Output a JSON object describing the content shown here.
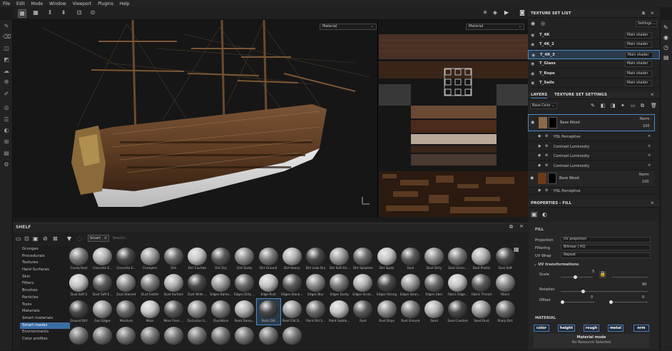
{
  "menu": [
    "File",
    "Edit",
    "Mode",
    "Window",
    "Viewport",
    "Plugins",
    "Help"
  ],
  "viewport": {
    "material_3d": "Material",
    "material_2d": "Material"
  },
  "shelf": {
    "title": "SHELF",
    "filter_tag": "Smart",
    "search_placeholder": "Search...",
    "categories": [
      "Grunges",
      "Procedurals",
      "Textures",
      "Hard Surfaces",
      "Skin",
      "Filters",
      "Brushes",
      "Particles",
      "Tools",
      "Materials",
      "Smart materials",
      "Smart masks",
      "Environments",
      "Color profiles"
    ],
    "selected_category": "Smart masks",
    "items": [
      [
        "Cavity Rust",
        "Concrete E...",
        "Concrete E...",
        "Crumples",
        "Dirt",
        "Dirt Cavities",
        "Dirt Dry",
        "Dirt Dusty",
        "Dirt Ground",
        "Dirt Heavy",
        "Dirt Leak Dry",
        "Dirt Soft Ed...",
        "Dirt Splashes",
        "Dirt Spots",
        "Dust",
        "Dust Dirty",
        "Dust Occlu...",
        "Dust Plastic",
        "Dust Soft"
      ],
      [
        "Dust Soft 2",
        "Dust Soft E...",
        "Dust Stained",
        "Dust Subtle",
        "Dust Surface",
        "Dust Wide ...",
        "Edges Dama...",
        "Edges Dirty ...",
        "Edge Rust",
        "Edges Stone...",
        "Edges Blur",
        "Edges Dusty",
        "Edges Scrat...",
        "Edges Strong",
        "Edges Stron...",
        "Edges Uber",
        "Fabric Edge...",
        "Fabric Thread",
        "Fibers"
      ],
      [
        "Ground Dirt",
        "Gun Edges",
        "Moisture",
        "Moss",
        "Moss From ...",
        "Occlusion S...",
        "Oxydation",
        "Paint Dama...",
        "Paint Old",
        "Paint Old D...",
        "Paint Old S...",
        "Paint Subtle...",
        "Rust",
        "Rust Drips",
        "Rust Ground",
        "Sand",
        "Sand Cavities",
        "Sand Dust",
        "Sharp Dirt"
      ]
    ],
    "selected_item": "Paint Old"
  },
  "texture_set_list": {
    "title": "TEXTURE SET LIST",
    "settings_label": "Settings",
    "sets": [
      {
        "name": "T_4K",
        "shader": "Main shader"
      },
      {
        "name": "T_4K_2",
        "shader": "Main shader"
      },
      {
        "name": "T_4K_3",
        "shader": "Main shader"
      },
      {
        "name": "T_Glass",
        "shader": "Main shader"
      },
      {
        "name": "T_Rope",
        "shader": "Main shader"
      },
      {
        "name": "T_Sails",
        "shader": "Main shader"
      }
    ],
    "selected": "T_4K_3"
  },
  "layers": {
    "tab_layers": "LAYERS",
    "tab_tss": "TEXTURE SET SETTINGS",
    "channel": "Base Color",
    "group1": {
      "name": "Base Wood",
      "blend": "Norm",
      "opacity": "100"
    },
    "effects": [
      "HSL Perceptive",
      "Contrast Luminosity",
      "Contrast Luminosity",
      "Contrast Luminosity"
    ],
    "group2": {
      "name": "Base Wood",
      "blend": "Norm",
      "opacity": "100"
    },
    "effects2": [
      "HSL Perceptive"
    ]
  },
  "properties": {
    "title": "PROPERTIES - FILL",
    "section_fill": "FILL",
    "projection_label": "Projection",
    "projection": "UV projection",
    "filtering_label": "Filtering",
    "filtering": "Bilinear | HQ",
    "uvwrap_label": "UV Wrap",
    "uvwrap": "Repeat",
    "uvt_label": "UV transformations",
    "scale_label": "Scale",
    "scale": "5",
    "scale_fraction": 0.45,
    "rotation_label": "Rotation",
    "rotation": "90",
    "rotation_fraction": 0.25,
    "offset_label": "Offset",
    "offset_a": "0",
    "offset_b": "0",
    "material_label": "MATERIAL",
    "chips": [
      "color",
      "height",
      "rough",
      "metal",
      "nrm"
    ],
    "material_mode": "Material mode",
    "no_resource": "No Resource Selected"
  },
  "colors": {
    "accent": "#3a6ea5",
    "panel": "#222222",
    "bg": "#1b1b1b"
  }
}
